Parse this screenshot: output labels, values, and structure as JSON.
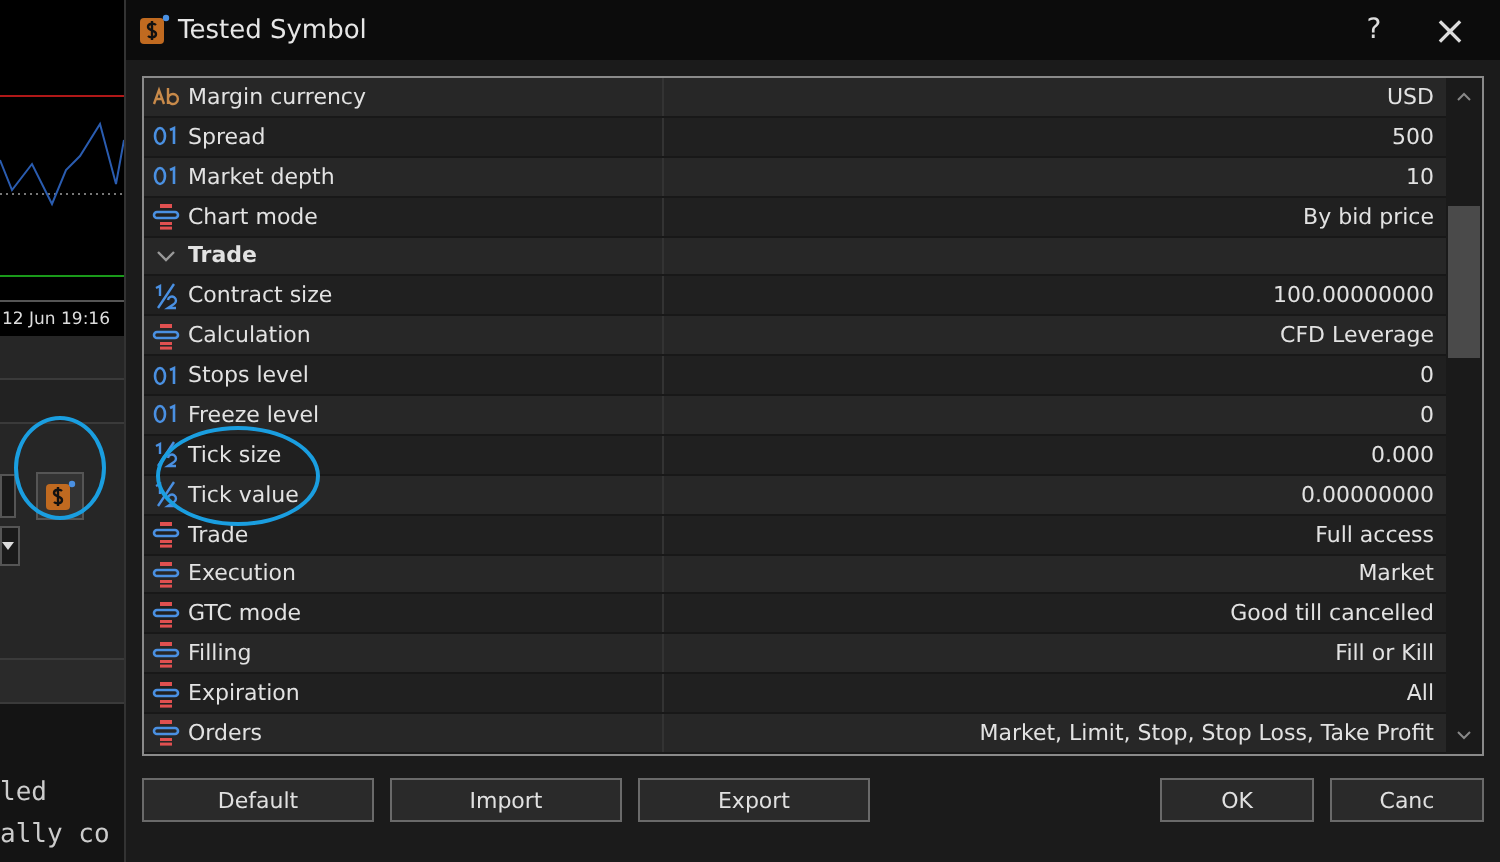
{
  "background": {
    "chart_time": "12 Jun 19:16",
    "log_lines": [
      "led",
      "ally co"
    ]
  },
  "dialog": {
    "title": "Tested Symbol",
    "help": "?",
    "close": "×",
    "rows": [
      {
        "kind": "text",
        "name": "Margin currency",
        "value": "USD",
        "highlighted": false
      },
      {
        "kind": "integer",
        "name": "Spread",
        "value": "500",
        "highlighted": false
      },
      {
        "kind": "integer",
        "name": "Market depth",
        "value": "10",
        "highlighted": false
      },
      {
        "kind": "enum",
        "name": "Chart mode",
        "value": "By bid price",
        "highlighted": false
      },
      {
        "kind": "group",
        "name": "Trade",
        "expanded": true
      },
      {
        "kind": "double",
        "name": "Contract size",
        "value": "100.00000000",
        "highlighted": false
      },
      {
        "kind": "enum",
        "name": "Calculation",
        "value": "CFD Leverage",
        "highlighted": false
      },
      {
        "kind": "integer",
        "name": "Stops level",
        "value": "0",
        "highlighted": false
      },
      {
        "kind": "integer",
        "name": "Freeze level",
        "value": "0",
        "highlighted": false
      },
      {
        "kind": "double",
        "name": "Tick size",
        "value": "0.000",
        "highlighted": true
      },
      {
        "kind": "double",
        "name": "Tick value",
        "value": "0.00000000",
        "highlighted": true
      },
      {
        "kind": "enum",
        "name": "Trade",
        "value": "Full access",
        "highlighted": false
      },
      {
        "kind": "enum",
        "name": "Execution",
        "value": "Market",
        "highlighted": false
      },
      {
        "kind": "enum",
        "name": "GTC mode",
        "value": "Good till cancelled",
        "highlighted": false
      },
      {
        "kind": "enum",
        "name": "Filling",
        "value": "Fill or Kill",
        "highlighted": false
      },
      {
        "kind": "enum",
        "name": "Expiration",
        "value": "All",
        "highlighted": false
      },
      {
        "kind": "enum",
        "name": "Orders",
        "value": "Market, Limit, Stop, Stop Loss, Take Profit",
        "highlighted": false
      }
    ],
    "left_buttons": [
      "Default",
      "Import",
      "Export"
    ],
    "right_buttons": [
      "OK",
      "Canc"
    ]
  }
}
